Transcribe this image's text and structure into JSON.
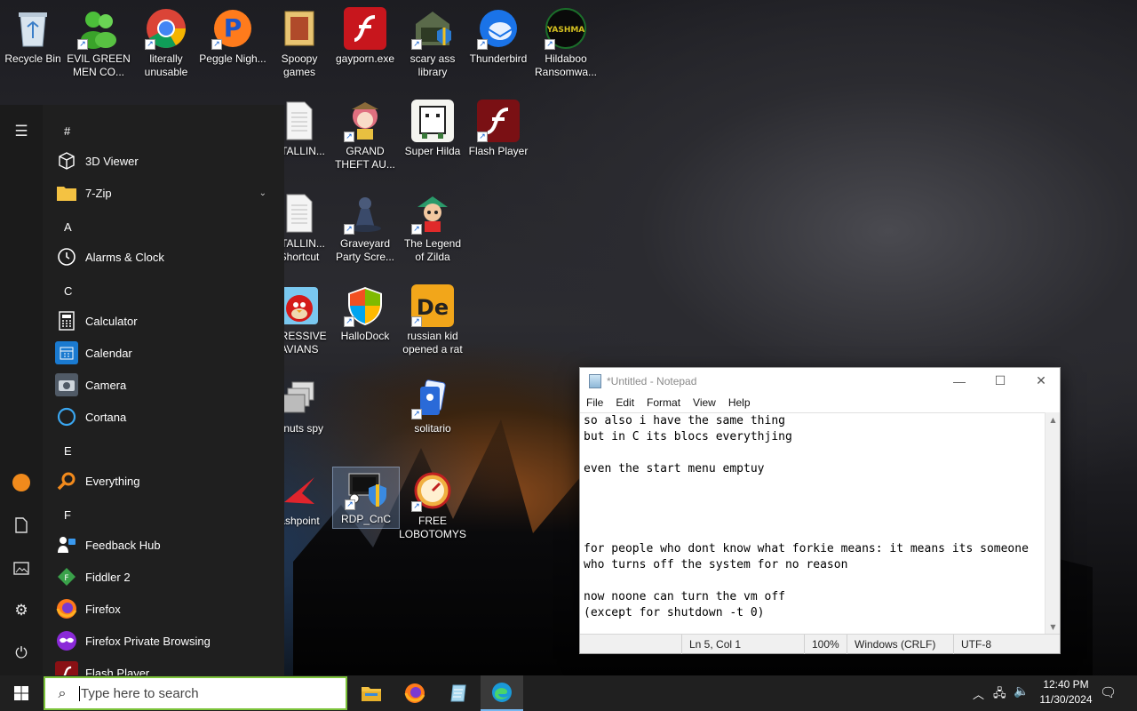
{
  "desktop": {
    "icons": [
      {
        "label": "Recycle Bin",
        "icon": "recycle-bin-icon"
      },
      {
        "label": "EVIL GREEN MEN CO...",
        "icon": "green-men-icon"
      },
      {
        "label": "literally unusable",
        "icon": "chrome-icon"
      },
      {
        "label": "Peggle Nigh...",
        "icon": "peggle-icon"
      },
      {
        "label": "Spoopy games",
        "icon": "folder-icon"
      },
      {
        "label": "gayporn.exe",
        "icon": "flash-icon"
      },
      {
        "label": "scary ass library",
        "icon": "library-icon"
      },
      {
        "label": "Thunderbird",
        "icon": "thunderbird-icon"
      },
      {
        "label": "Hildaboo Ransomwa...",
        "icon": "yashma-icon"
      },
      {
        "label": "STALLIN...",
        "icon": "document-icon"
      },
      {
        "label": "GRAND THEFT AU...",
        "icon": "anime-girl-icon"
      },
      {
        "label": "Super Hilda",
        "icon": "pixel-cat-icon"
      },
      {
        "label": "Flash Player",
        "icon": "flash-icon"
      },
      {
        "label": "STALLIN... Shortcut",
        "icon": "document-icon"
      },
      {
        "label": "Graveyard Party Scre...",
        "icon": "graveyard-icon"
      },
      {
        "label": "The Legend of Zilda",
        "icon": "zelda-icon"
      },
      {
        "label": "GRESSIVE AVIANS",
        "icon": "angry-bird-icon"
      },
      {
        "label": "HalloDock",
        "icon": "shield-icon"
      },
      {
        "label": "russian kid opened a rat",
        "icon": "de-icon"
      },
      {
        "label": "z nuts spy",
        "icon": "windows-stack-icon"
      },
      {
        "label": "solitario",
        "icon": "solitaire-icon"
      },
      {
        "label": "ashpoint",
        "icon": "flashpoint-icon"
      },
      {
        "label": "RDP_CnC",
        "icon": "rdp-icon"
      },
      {
        "label": "FREE LOBOTOMYS",
        "icon": "gauge-icon"
      }
    ]
  },
  "start_menu": {
    "headers": {
      "hash": "#",
      "a": "A",
      "c": "C",
      "e": "E",
      "f": "F"
    },
    "apps": [
      {
        "label": "3D Viewer",
        "icon": "cube-icon"
      },
      {
        "label": "7-Zip",
        "icon": "folder-icon"
      },
      {
        "label": "Alarms & Clock",
        "icon": "clock-icon"
      },
      {
        "label": "Calculator",
        "icon": "calculator-icon"
      },
      {
        "label": "Calendar",
        "icon": "calendar-icon"
      },
      {
        "label": "Camera",
        "icon": "camera-icon"
      },
      {
        "label": "Cortana",
        "icon": "cortana-icon"
      },
      {
        "label": "Everything",
        "icon": "magnifier-icon"
      },
      {
        "label": "Feedback Hub",
        "icon": "feedback-icon"
      },
      {
        "label": "Fiddler 2",
        "icon": "fiddler-icon"
      },
      {
        "label": "Firefox",
        "icon": "firefox-icon"
      },
      {
        "label": "Firefox Private Browsing",
        "icon": "private-browsing-icon"
      },
      {
        "label": "Flash Player",
        "icon": "flash-icon"
      }
    ]
  },
  "notepad": {
    "title": "*Untitled - Notepad",
    "menu": [
      "File",
      "Edit",
      "Format",
      "View",
      "Help"
    ],
    "text": "so also i have the same thing\nbut in C its blocs everythjing\n\neven the start menu emptuy\n\n\n\n\nfor people who dont know what forkie means: it means its someone\nwho turns off the system for no reason\n\nnow noone can turn the vm off\n(except for shutdown -t 0)",
    "status": {
      "position": "Ln 5, Col 1",
      "zoom": "100%",
      "line_ending": "Windows (CRLF)",
      "encoding": "UTF-8"
    }
  },
  "taskbar": {
    "search_placeholder": "Type here to search",
    "time": "12:40 PM",
    "date": "11/30/2024"
  }
}
